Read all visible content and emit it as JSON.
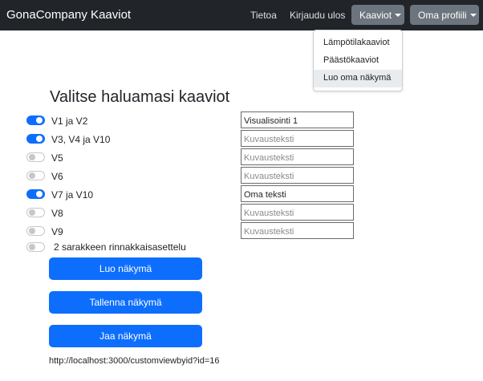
{
  "navbar": {
    "brand": "GonaCompany Kaaviot",
    "links": {
      "tietoa": "Tietoa",
      "logout": "Kirjaudu ulos"
    },
    "charts_menu": "Kaaviot",
    "profile_menu": "Oma profiili"
  },
  "dropdown": {
    "items": [
      "Lämpötilakaaviot",
      "Päästökaaviot",
      "Luo oma näkymä"
    ],
    "active_item": "Luo oma näkymä"
  },
  "form": {
    "heading": "Valitse haluamasi kaaviot",
    "rows": [
      {
        "label": "V1 ja V2",
        "checked": true,
        "value": "Visualisointi 1",
        "placeholder": "Kuvausteksti"
      },
      {
        "label": "V3, V4 ja V10",
        "checked": true,
        "value": "",
        "placeholder": "Kuvausteksti"
      },
      {
        "label": "V5",
        "checked": false,
        "value": "",
        "placeholder": "Kuvausteksti"
      },
      {
        "label": "V6",
        "checked": false,
        "value": "",
        "placeholder": "Kuvausteksti"
      },
      {
        "label": "V7 ja V10",
        "checked": true,
        "value": "Oma teksti",
        "placeholder": "Kuvausteksti"
      },
      {
        "label": "V8",
        "checked": false,
        "value": "",
        "placeholder": "Kuvausteksti"
      },
      {
        "label": "V9",
        "checked": false,
        "value": "",
        "placeholder": "Kuvausteksti"
      }
    ],
    "two_column": {
      "label": "2 sarakkeen rinnakkaisasettelu",
      "checked": false
    }
  },
  "buttons": {
    "create": "Luo näkymä",
    "save": "Tallenna näkymä",
    "share": "Jaa näkymä"
  },
  "share_url": "http://localhost:3000/customviewbyid?id=16",
  "colors": {
    "navbar": "#212529",
    "primary": "#0d6efd",
    "secondary": "#6c757d"
  }
}
